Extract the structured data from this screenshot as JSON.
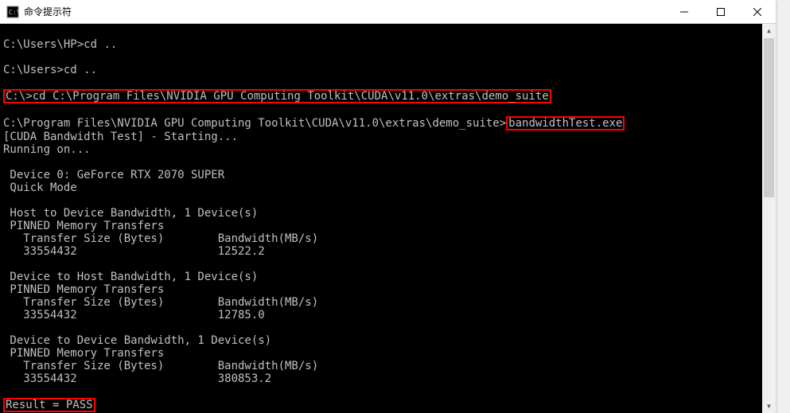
{
  "window": {
    "title": "命令提示符"
  },
  "lines": {
    "l1_prompt": "C:\\Users\\HP>",
    "l1_cmd": "cd ..",
    "l2_prompt": "C:\\Users>",
    "l2_cmd": "cd ..",
    "l3_prompt": "C:\\>",
    "l3_cmd": "cd C:\\Program Files\\NVIDIA GPU Computing Toolkit\\CUDA\\v11.0\\extras\\demo_suite",
    "l4_prompt": "C:\\Program Files\\NVIDIA GPU Computing Toolkit\\CUDA\\v11.0\\extras\\demo_suite>",
    "l4_cmd": "bandwidthTest.exe",
    "l5": "[CUDA Bandwidth Test] - Starting...",
    "l6": "Running on...",
    "l7": " Device 0: GeForce RTX 2070 SUPER",
    "l8": " Quick Mode",
    "l9": " Host to Device Bandwidth, 1 Device(s)",
    "l10": " PINNED Memory Transfers",
    "l11": "   Transfer Size (Bytes)        Bandwidth(MB/s)",
    "l12": "   33554432                     12522.2",
    "l13": " Device to Host Bandwidth, 1 Device(s)",
    "l14": " PINNED Memory Transfers",
    "l15": "   Transfer Size (Bytes)        Bandwidth(MB/s)",
    "l16": "   33554432                     12785.0",
    "l17": " Device to Device Bandwidth, 1 Device(s)",
    "l18": " PINNED Memory Transfers",
    "l19": "   Transfer Size (Bytes)        Bandwidth(MB/s)",
    "l20": "   33554432                     380853.2",
    "l21": "Result = PASS"
  }
}
